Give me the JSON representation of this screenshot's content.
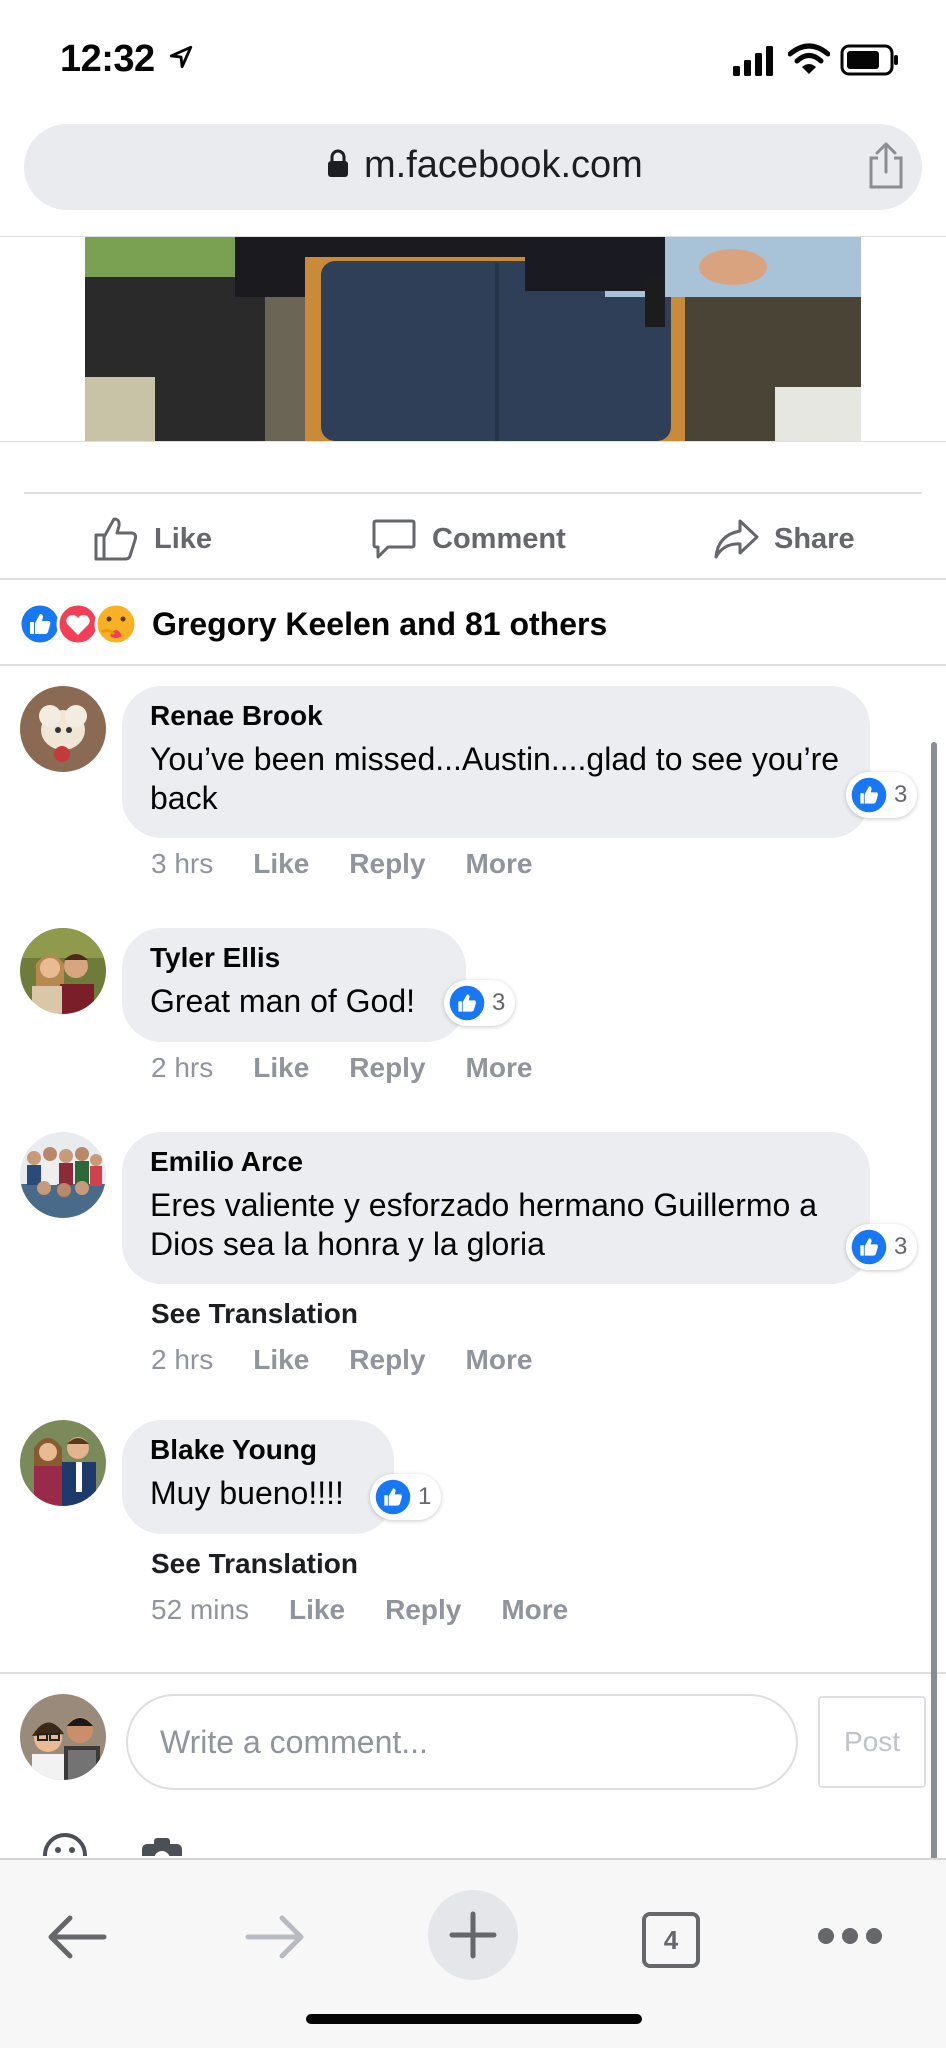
{
  "status_bar": {
    "time": "12:32"
  },
  "url_bar": {
    "domain": "m.facebook.com"
  },
  "actions": {
    "like": "Like",
    "comment": "Comment",
    "share": "Share"
  },
  "reactions": {
    "summary": "Gregory Keelen and 81 others"
  },
  "comments": [
    {
      "name": "Renae Brook",
      "text": "You’ve been missed...Austin....glad to see you’re back",
      "likes": "3",
      "time": "3 hrs",
      "like": "Like",
      "reply": "Reply",
      "more": "More"
    },
    {
      "name": "Tyler Ellis",
      "text": "Great man of God!",
      "likes": "3",
      "time": "2 hrs",
      "like": "Like",
      "reply": "Reply",
      "more": "More"
    },
    {
      "name": "Emilio Arce",
      "text": "Eres valiente y esforzado hermano Guillermo a Dios sea la honra y la gloria",
      "likes": "3",
      "see_translation": "See Translation",
      "time": "2 hrs",
      "like": "Like",
      "reply": "Reply",
      "more": "More"
    },
    {
      "name": "Blake Young",
      "text": "Muy bueno!!!!",
      "likes": "1",
      "see_translation": "See Translation",
      "time": "52 mins",
      "like": "Like",
      "reply": "Reply",
      "more": "More"
    }
  ],
  "composer": {
    "placeholder": "Write a comment...",
    "post_label": "Post"
  },
  "toolbar": {
    "tab_count": "4"
  },
  "colors": {
    "like_blue": "#1877f2",
    "love_red": "#f33e58",
    "care_yellow": "#f7b125",
    "bubble_gray": "#ebedf0",
    "meta_gray": "#90949c"
  }
}
